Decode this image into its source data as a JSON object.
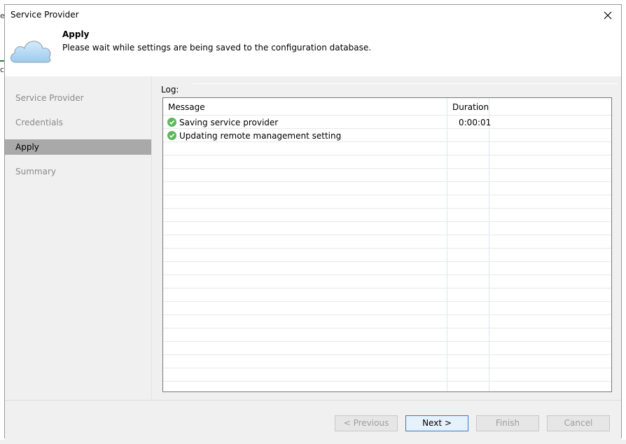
{
  "window": {
    "title": "Service Provider"
  },
  "background": {
    "char_top": "e",
    "char_mid": "c"
  },
  "header": {
    "title": "Apply",
    "subtitle": "Please wait while settings are being saved to the configuration database.",
    "icon": "cloud-icon"
  },
  "sidebar": {
    "items": [
      {
        "label": "Service Provider",
        "state": "done"
      },
      {
        "label": "Credentials",
        "state": "done"
      },
      {
        "label": "Apply",
        "state": "active"
      },
      {
        "label": "Summary",
        "state": "pending"
      }
    ]
  },
  "log": {
    "label": "Log:",
    "columns": [
      "Message",
      "Duration"
    ],
    "rows": [
      {
        "status": "success",
        "message": "Saving service provider",
        "duration": "0:00:01"
      },
      {
        "status": "success",
        "message": "Updating remote management setting",
        "duration": ""
      }
    ]
  },
  "footer": {
    "previous": "< Previous",
    "next": "Next >",
    "finish": "Finish",
    "cancel": "Cancel"
  },
  "colors": {
    "active_nav": "#a9a9a9",
    "success": "#5cb85c",
    "primary_border": "#2a7fd4"
  }
}
